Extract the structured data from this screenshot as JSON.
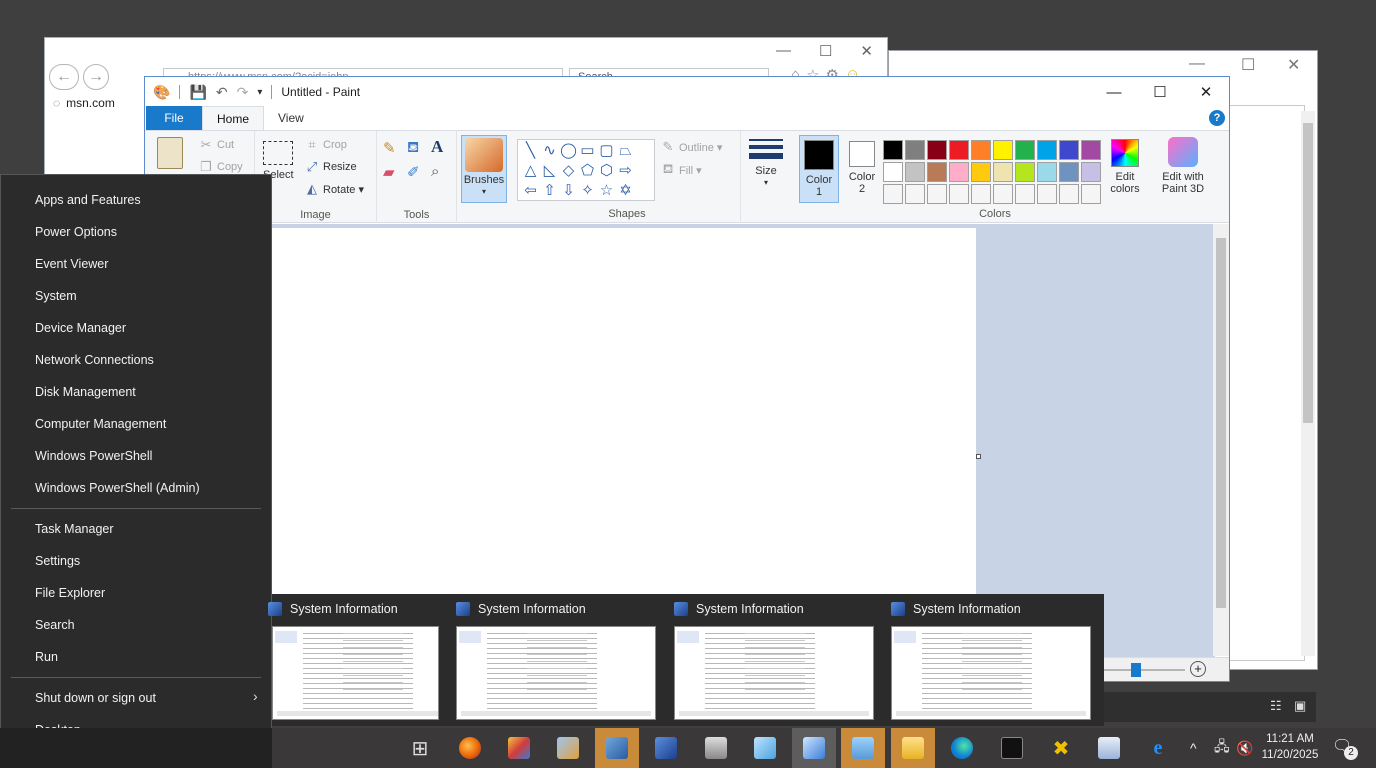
{
  "back_window": {
    "minimize": "—",
    "maximize": "☐",
    "close": "✕"
  },
  "ie": {
    "address": "https://www.msn.com/?ocid=iehp",
    "search_placeholder": "Search",
    "tab_label": "msn.com",
    "back": "←",
    "forward": "→",
    "minimize": "—",
    "maximize": "☐",
    "close": "✕"
  },
  "paint": {
    "title": "Untitled - Paint",
    "tabs": {
      "file": "File",
      "home": "Home",
      "view": "View"
    },
    "help": "?",
    "window": {
      "minimize": "—",
      "maximize": "☐",
      "close": "✕"
    },
    "clipboard": {
      "cut": "Cut",
      "copy": "Copy"
    },
    "image": {
      "select": "Select",
      "crop": "Crop",
      "resize": "Resize",
      "rotate": "Rotate ▾",
      "label": "Image"
    },
    "tools": {
      "label": "Tools",
      "text": "A"
    },
    "brushes": {
      "label": "Brushes"
    },
    "shapes": {
      "outline": "Outline ▾",
      "fill": "Fill ▾",
      "label": "Shapes"
    },
    "size": {
      "label": "Size"
    },
    "colors": {
      "color1": "Color 1",
      "color2": "Color 2",
      "edit_colors": "Edit colors",
      "edit_3d": "Edit with Paint 3D",
      "label": "Colors",
      "palette": [
        "#000000",
        "#7f7f7f",
        "#880015",
        "#ed1c24",
        "#ff7f27",
        "#fff200",
        "#22b14c",
        "#00a2e8",
        "#3f48cc",
        "#a349a4",
        "#ffffff",
        "#c3c3c3",
        "#b97a57",
        "#ffaec9",
        "#ffc90e",
        "#efe4b0",
        "#b5e61d",
        "#99d9ea",
        "#7092be",
        "#c8bfe7",
        "#f5f5f5",
        "#f5f5f5",
        "#f5f5f5",
        "#f5f5f5",
        "#f5f5f5",
        "#f5f5f5",
        "#f5f5f5",
        "#f5f5f5",
        "#f5f5f5",
        "#f5f5f5"
      ]
    },
    "zoom_plus": "+"
  },
  "winx_menu": {
    "items": [
      "Apps and Features",
      "Power Options",
      "Event Viewer",
      "System",
      "Device Manager",
      "Network Connections",
      "Disk Management",
      "Computer Management",
      "Windows PowerShell",
      "Windows PowerShell (Admin)"
    ],
    "items2": [
      "Task Manager",
      "Settings",
      "File Explorer",
      "Search",
      "Run"
    ],
    "shutdown": "Shut down or sign out",
    "desktop": "Desktop",
    "chevron": "›"
  },
  "thumbnails": [
    {
      "title": "System Information"
    },
    {
      "title": "System Information"
    },
    {
      "title": "System Information"
    },
    {
      "title": "System Information"
    }
  ],
  "taskbar": {
    "clock_time": "11:21 AM",
    "clock_date": "11/20/2025",
    "notification_count": "2",
    "tray_chevron": "^"
  }
}
